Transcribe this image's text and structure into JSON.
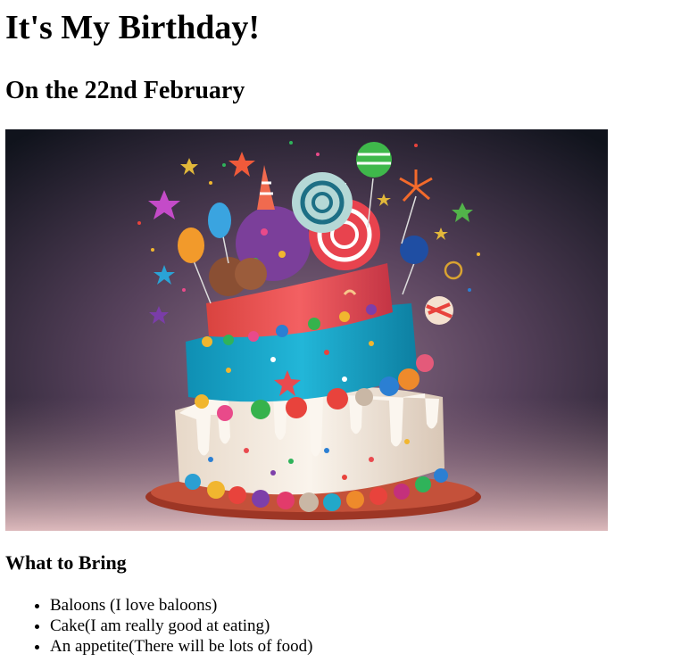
{
  "page": {
    "title": "It's My Birthday!",
    "subtitle": "On the 22nd February",
    "image": {
      "description": "birthday-cake-image",
      "colors": {
        "bg_dark": "#151521",
        "bg_mid": "#5a4660",
        "bg_light": "#d9b6bd",
        "tier_cream": "#f3ece2",
        "tier_teal": "#1aa6c9",
        "tier_red": "#e94a4f",
        "plate": "#b9432f"
      }
    },
    "section_heading": "What to Bring",
    "items": [
      "Baloons (I love baloons)",
      "Cake(I am really good at eating)",
      "An appetite(There will be lots of food)"
    ]
  }
}
